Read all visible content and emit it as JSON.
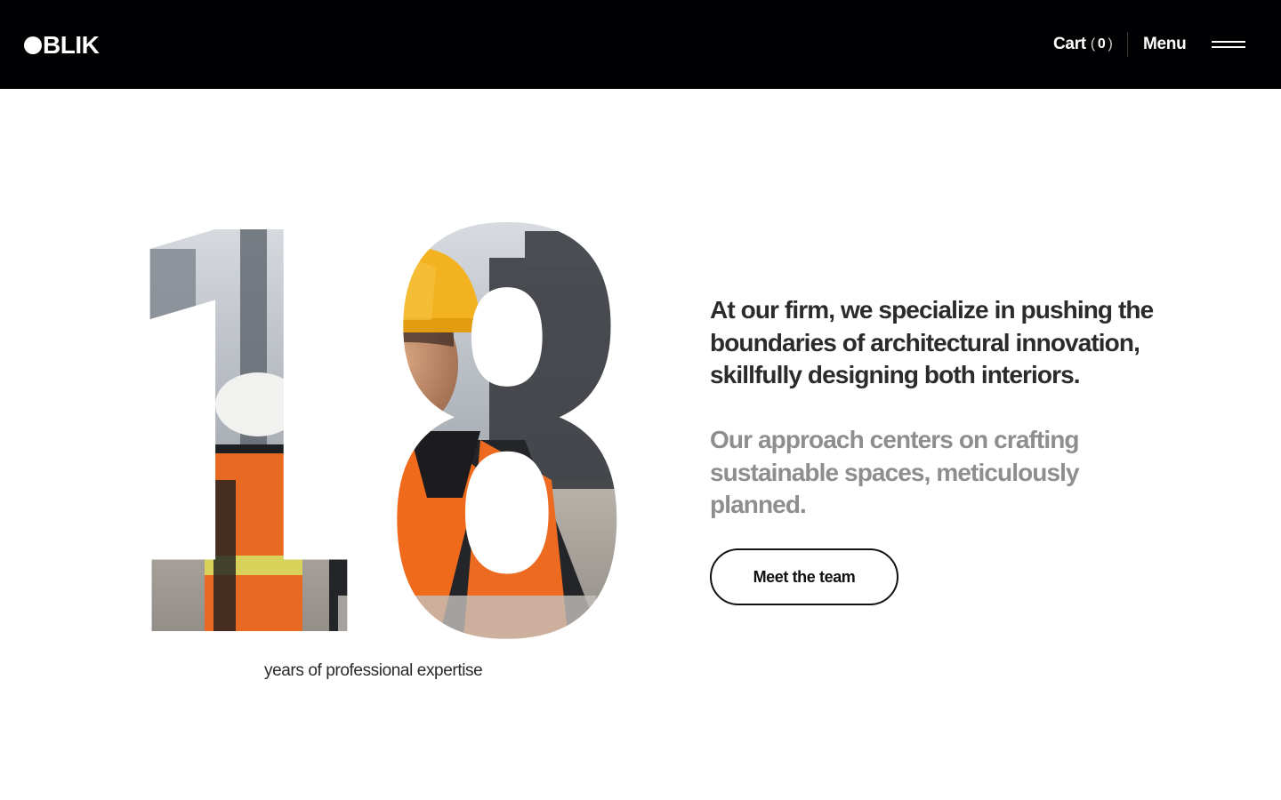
{
  "header": {
    "logo_text": "BLIK",
    "cart_label": "Cart",
    "cart_open_paren": "(",
    "cart_count": "0",
    "cart_close_paren": ")",
    "menu_label": "Menu"
  },
  "hero": {
    "number": "18",
    "number_caption": "years of professional expertise",
    "lead_text": "At our firm, we specialize in pushing the boundaries of architectural innovation, skillfully designing both interiors.",
    "sub_text": "Our approach centers on crafting sustainable spaces, meticulously planned.",
    "cta_label": "Meet the team"
  },
  "icons": {
    "logo": "filled-circle-icon",
    "menu": "hamburger-icon"
  },
  "colors": {
    "header_bg": "#010103",
    "text_dark": "#2b2b2d",
    "text_muted": "#8e8e90",
    "vest_orange": "#f06a1c",
    "helmet_yellow": "#f3b21f"
  }
}
